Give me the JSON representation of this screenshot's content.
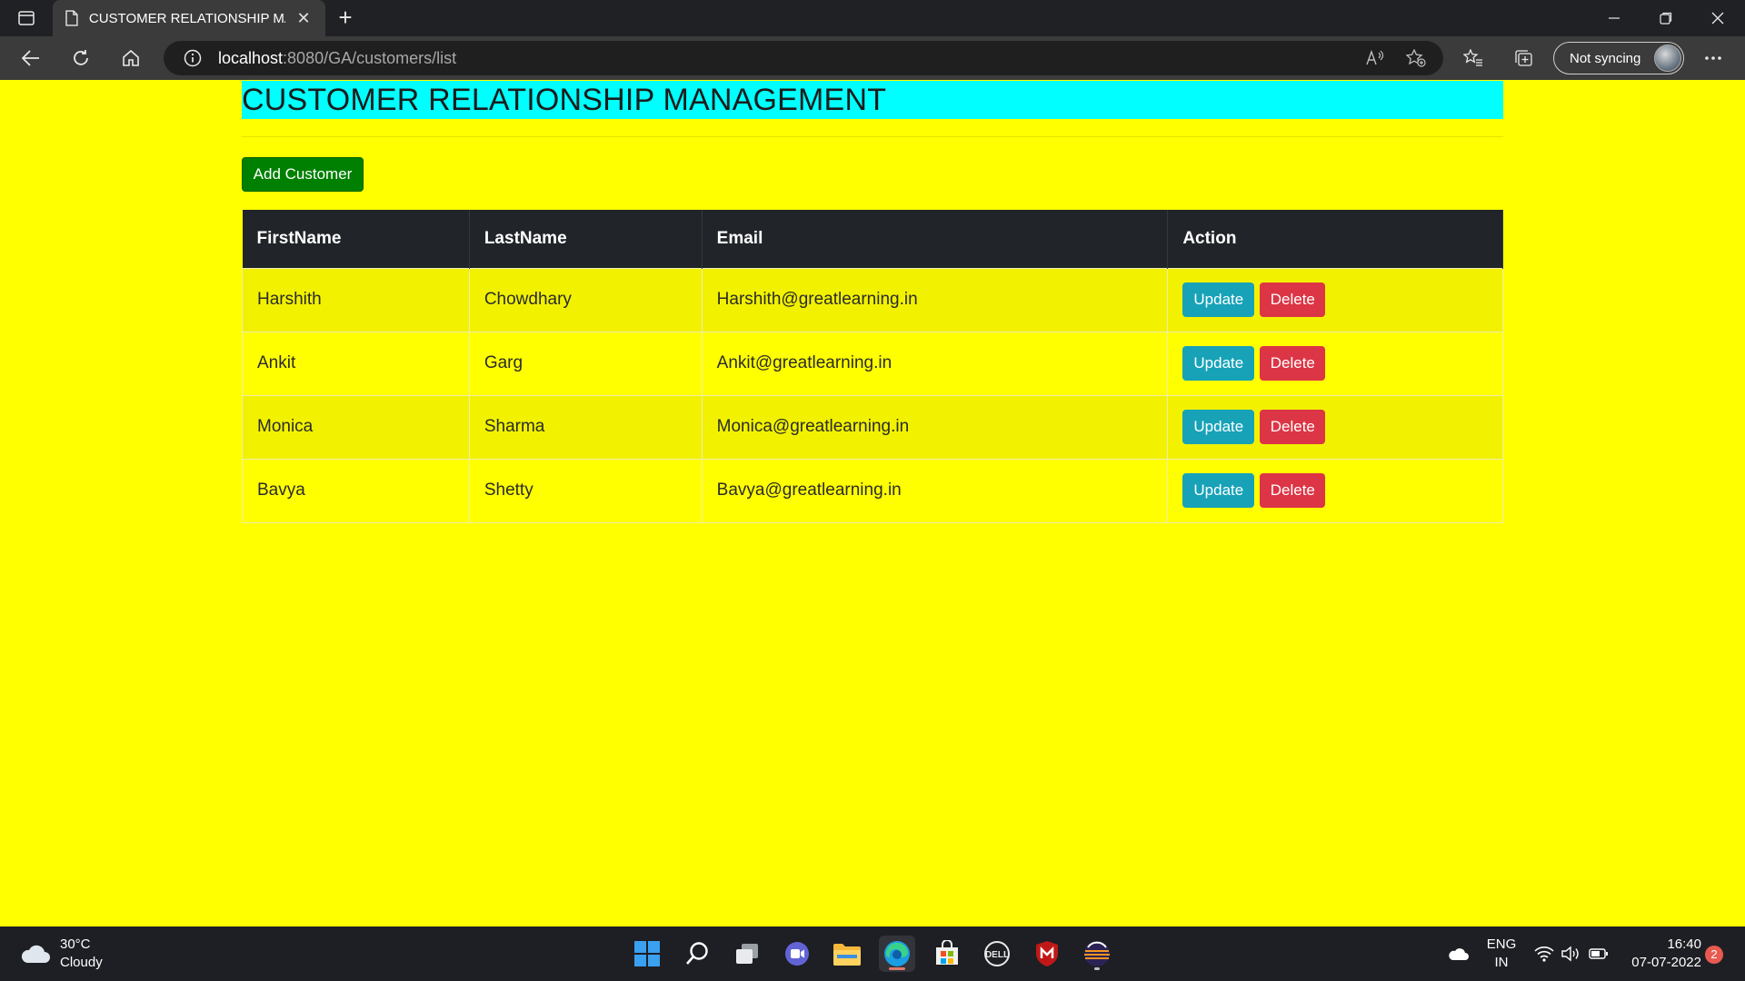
{
  "browser": {
    "tab_title": "CUSTOMER RELATIONSHIP MANAGEMENT",
    "url_host": "localhost",
    "url_path": ":8080/GA/customers/list",
    "sync_label": "Not syncing"
  },
  "page": {
    "heading": "CUSTOMER RELATIONSHIP MANAGEMENT",
    "add_button": "Add Customer",
    "columns": [
      "FirstName",
      "LastName",
      "Email",
      "Action"
    ],
    "customers": [
      {
        "first": "Harshith",
        "last": "Chowdhary",
        "email": "Harshith@greatlearning.in"
      },
      {
        "first": "Ankit",
        "last": "Garg",
        "email": "Ankit@greatlearning.in"
      },
      {
        "first": "Monica",
        "last": "Sharma",
        "email": "Monica@greatlearning.in"
      },
      {
        "first": "Bavya",
        "last": "Shetty",
        "email": "Bavya@greatlearning.in"
      }
    ],
    "update_label": "Update",
    "delete_label": "Delete",
    "colors": {
      "background": "#ffff00",
      "heading_bg": "#00ffff",
      "add_button": "#008000",
      "table_header": "#212529",
      "update_button": "#17a2b8",
      "delete_button": "#dc3545"
    }
  },
  "taskbar": {
    "weather_temp": "30°C",
    "weather_desc": "Cloudy",
    "lang_line1": "ENG",
    "lang_line2": "IN",
    "time": "16:40",
    "date": "07-07-2022",
    "notification_count": "2",
    "apps": [
      "start-icon",
      "search-icon",
      "task-view-icon",
      "teams-chat-icon",
      "file-explorer-icon",
      "edge-icon",
      "store-icon",
      "dell-icon",
      "mcafee-icon",
      "eclipse-icon"
    ]
  }
}
